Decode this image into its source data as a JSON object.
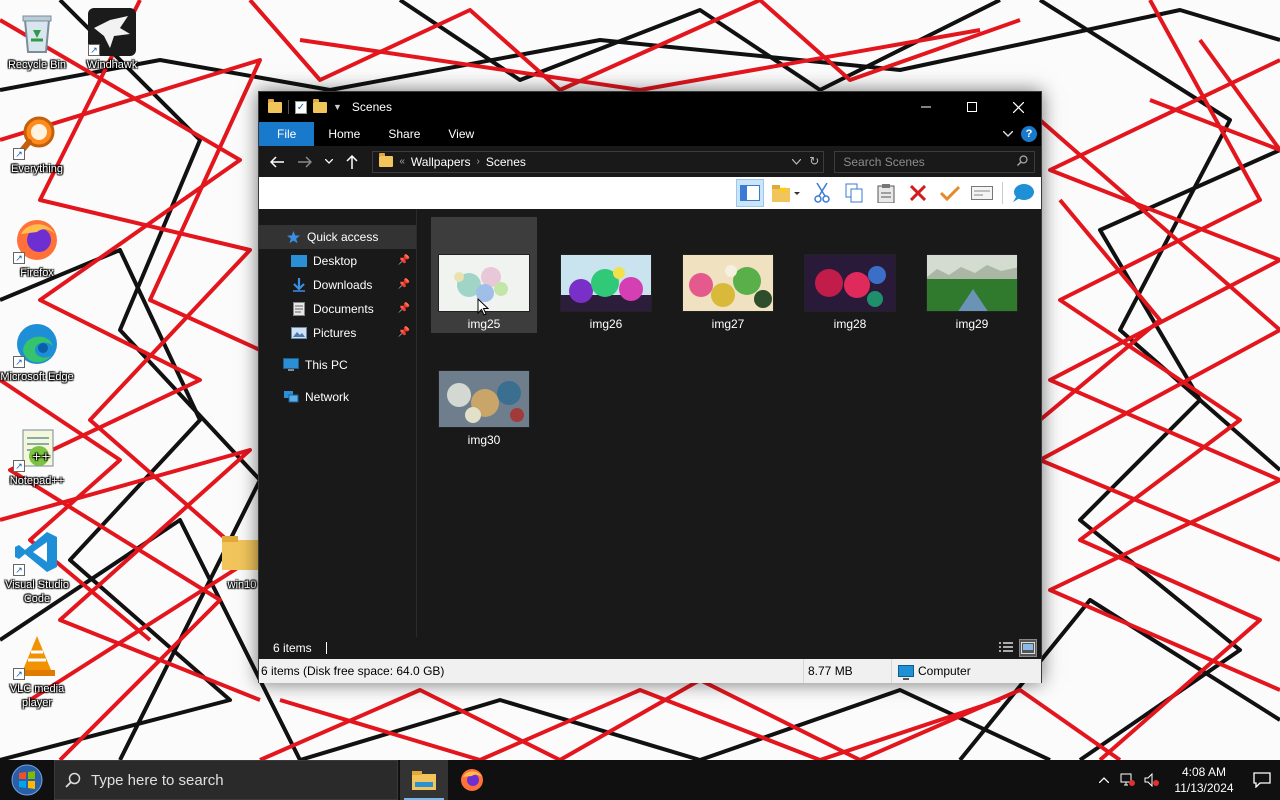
{
  "colors": {
    "wallpaper_red": "#e3161e",
    "wallpaper_black": "#111111",
    "file_tab": "#1979ca",
    "window_bg": "#191919",
    "selection": "#3d3d3d"
  },
  "desktop": {
    "icons": [
      {
        "label": "Recycle Bin",
        "icon": "recycle-bin-icon"
      },
      {
        "label": "Windhawk",
        "icon": "windhawk-icon"
      },
      {
        "label": "Everything",
        "icon": "everything-search-icon"
      },
      {
        "label": "Firefox",
        "icon": "firefox-icon"
      },
      {
        "label": "Microsoft Edge",
        "icon": "edge-icon"
      },
      {
        "label": "Notepad++",
        "icon": "notepad-plus-plus-icon"
      },
      {
        "label": "Visual Studio Code",
        "icon": "vscode-icon"
      },
      {
        "label": "VLC media player",
        "icon": "vlc-icon"
      },
      {
        "label": "win10",
        "icon": "folder-icon"
      }
    ]
  },
  "window": {
    "title": "Scenes",
    "ribbon_tabs": [
      "File",
      "Home",
      "Share",
      "View"
    ],
    "help": "?",
    "address": {
      "overflow": "«",
      "crumbs": [
        "Wallpapers",
        "Scenes"
      ]
    },
    "search_placeholder": "Search Scenes",
    "nav": {
      "quick_access": "Quick access",
      "pinned": [
        {
          "label": "Desktop",
          "icon": "desktop-folder-icon"
        },
        {
          "label": "Downloads",
          "icon": "downloads-folder-icon"
        },
        {
          "label": "Documents",
          "icon": "documents-folder-icon"
        },
        {
          "label": "Pictures",
          "icon": "pictures-folder-icon"
        }
      ],
      "this_pc": "This PC",
      "network": "Network"
    },
    "files": [
      {
        "name": "img25",
        "selected": true
      },
      {
        "name": "img26",
        "selected": false
      },
      {
        "name": "img27",
        "selected": false
      },
      {
        "name": "img28",
        "selected": false
      },
      {
        "name": "img29",
        "selected": false
      },
      {
        "name": "img30",
        "selected": false
      }
    ],
    "item_count": "6 items",
    "status": {
      "summary": "6 items (Disk free space: 64.0 GB)",
      "size": "8.77 MB",
      "location": "Computer"
    }
  },
  "taskbar": {
    "search_placeholder": "Type here to search",
    "time": "4:08 AM",
    "date": "11/13/2024"
  }
}
